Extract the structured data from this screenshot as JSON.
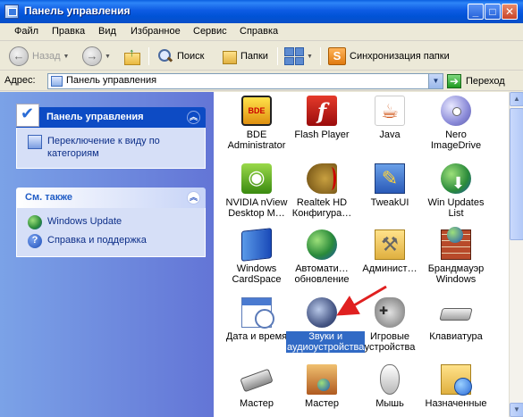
{
  "window": {
    "title": "Панель управления"
  },
  "menubar": [
    "Файл",
    "Правка",
    "Вид",
    "Избранное",
    "Сервис",
    "Справка"
  ],
  "toolbar": {
    "back_label": "Назад",
    "search_label": "Поиск",
    "folders_label": "Папки",
    "sync_label": "Синхронизация папки"
  },
  "addressbar": {
    "label": "Адрес:",
    "value": "Панель управления",
    "go_label": "Переход"
  },
  "left_pane": {
    "control_panel": {
      "title": "Панель управления",
      "switch_view": "Переключение к виду по категориям"
    },
    "see_also": {
      "title": "См. также",
      "items": [
        {
          "label": "Windows Update",
          "icon": "windows-update-icon"
        },
        {
          "label": "Справка и поддержка",
          "icon": "help-icon"
        }
      ]
    }
  },
  "items": [
    {
      "label": "BDE Administrator",
      "icon": "bde-administrator-icon"
    },
    {
      "label": "Flash Player",
      "icon": "flash-player-icon"
    },
    {
      "label": "Java",
      "icon": "java-icon"
    },
    {
      "label": "Nero ImageDrive",
      "icon": "nero-imagedrive-icon"
    },
    {
      "label": "NVIDIA nView Desktop M…",
      "icon": "nvidia-nview-icon"
    },
    {
      "label": "Realtek HD Конфигура…",
      "icon": "realtek-hd-icon"
    },
    {
      "label": "TweakUI",
      "icon": "tweakui-icon"
    },
    {
      "label": "Win Updates List",
      "icon": "win-updates-list-icon"
    },
    {
      "label": "Windows CardSpace",
      "icon": "windows-cardspace-icon"
    },
    {
      "label": "Автомати… обновление",
      "icon": "automatic-updates-icon"
    },
    {
      "label": "Админист…",
      "icon": "administrative-tools-icon"
    },
    {
      "label": "Брандмауэр Windows",
      "icon": "windows-firewall-icon"
    },
    {
      "label": "Дата и время",
      "icon": "date-time-icon"
    },
    {
      "label": "Звуки и аудиоустройства",
      "icon": "sounds-audio-icon",
      "selected": true
    },
    {
      "label": "Игровые устройства",
      "icon": "game-controllers-icon"
    },
    {
      "label": "Клавиатура",
      "icon": "keyboard-icon"
    },
    {
      "label": "Мастер",
      "icon": "wizard-icon"
    },
    {
      "label": "Мастер",
      "icon": "network-wizard-icon"
    },
    {
      "label": "Мышь",
      "icon": "mouse-icon"
    },
    {
      "label": "Назначенные",
      "icon": "scheduled-tasks-icon"
    }
  ],
  "colors": {
    "titlebar": "#0A5FE0",
    "selection": "#316AC5",
    "annotation_arrow": "#E02020"
  }
}
